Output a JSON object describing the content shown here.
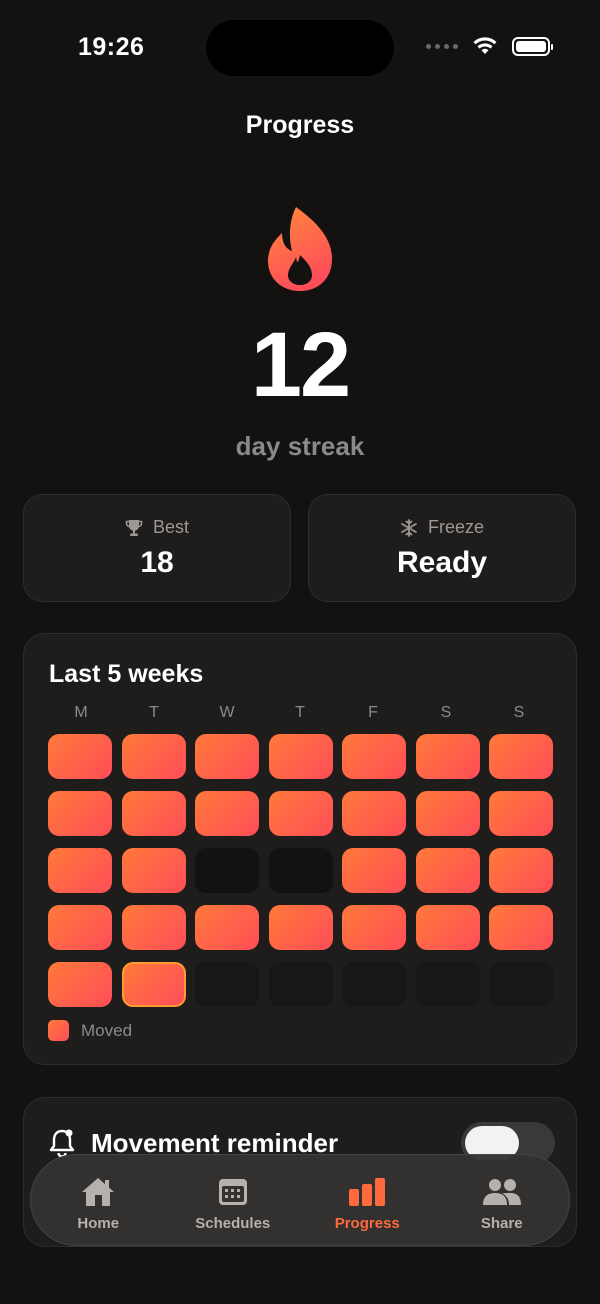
{
  "status_bar": {
    "time": "19:26"
  },
  "header": {
    "title": "Progress"
  },
  "streak": {
    "count": "12",
    "label": "day streak"
  },
  "stats": {
    "best": {
      "label": "Best",
      "value": "18",
      "icon": "trophy-icon"
    },
    "freeze": {
      "label": "Freeze",
      "value": "Ready",
      "icon": "snowflake-icon"
    }
  },
  "weeks": {
    "title": "Last 5 weeks",
    "days": [
      "M",
      "T",
      "W",
      "T",
      "F",
      "S",
      "S"
    ],
    "rows": [
      [
        "moved",
        "moved",
        "moved",
        "moved",
        "moved",
        "moved",
        "moved"
      ],
      [
        "moved",
        "moved",
        "moved",
        "moved",
        "moved",
        "moved",
        "moved"
      ],
      [
        "moved",
        "moved",
        "missed",
        "missed",
        "moved",
        "moved",
        "moved"
      ],
      [
        "moved",
        "moved",
        "moved",
        "moved",
        "moved",
        "moved",
        "moved"
      ],
      [
        "moved",
        "today",
        "future",
        "future",
        "future",
        "future",
        "future"
      ]
    ],
    "legend_label": "Moved"
  },
  "reminder": {
    "label": "Movement reminder",
    "enabled": false
  },
  "tabbar": {
    "items": [
      {
        "label": "Home",
        "icon": "home-icon"
      },
      {
        "label": "Schedules",
        "icon": "calendar-icon"
      },
      {
        "label": "Progress",
        "icon": "bar-chart-icon",
        "active": true
      },
      {
        "label": "Share",
        "icon": "people-icon"
      }
    ]
  },
  "colors": {
    "accent": "#ff6a3d",
    "gradient_start": "#ff7a3a",
    "gradient_end": "#ff4d57",
    "background": "#131211",
    "card": "#1f1d1c"
  }
}
